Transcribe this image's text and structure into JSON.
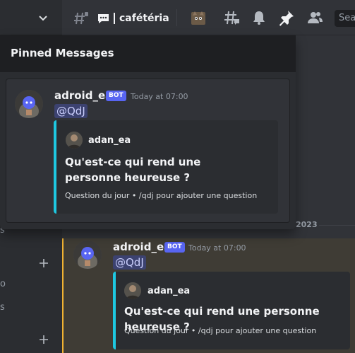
{
  "sidebar": {
    "fragments": [
      "s",
      "o",
      "s"
    ],
    "add_icon": "plus-icon"
  },
  "header": {
    "channel_icon": "speech-bubble-icon",
    "channel_name": "cafétéria",
    "search_placeholder": "Sea"
  },
  "pinned": {
    "title": "Pinned Messages",
    "message": {
      "author": "adroid_ea",
      "bot_tag": "BOT",
      "timestamp": "Today at 07:00",
      "mention": "@QdJ",
      "embed": {
        "author": "adan_ea",
        "title": "Qu'est-ce qui rend une personne heureuse ?",
        "footer": "Question du jour • /qdj pour ajouter une question"
      }
    }
  },
  "channel": {
    "date_divider": "2023",
    "message": {
      "author": "adroid_ea",
      "bot_tag": "BOT",
      "timestamp": "Today at 07:00",
      "mention": "@QdJ",
      "embed": {
        "author": "adan_ea",
        "title": "Qu'est-ce qui rend une personne heureuse ?",
        "footer": "Question du jour • /qdj pour ajouter une question"
      }
    }
  },
  "colors": {
    "accent_embed": "#1ec8e1",
    "bot_badge": "#5865f2",
    "highlight_bar": "#f0b232"
  }
}
